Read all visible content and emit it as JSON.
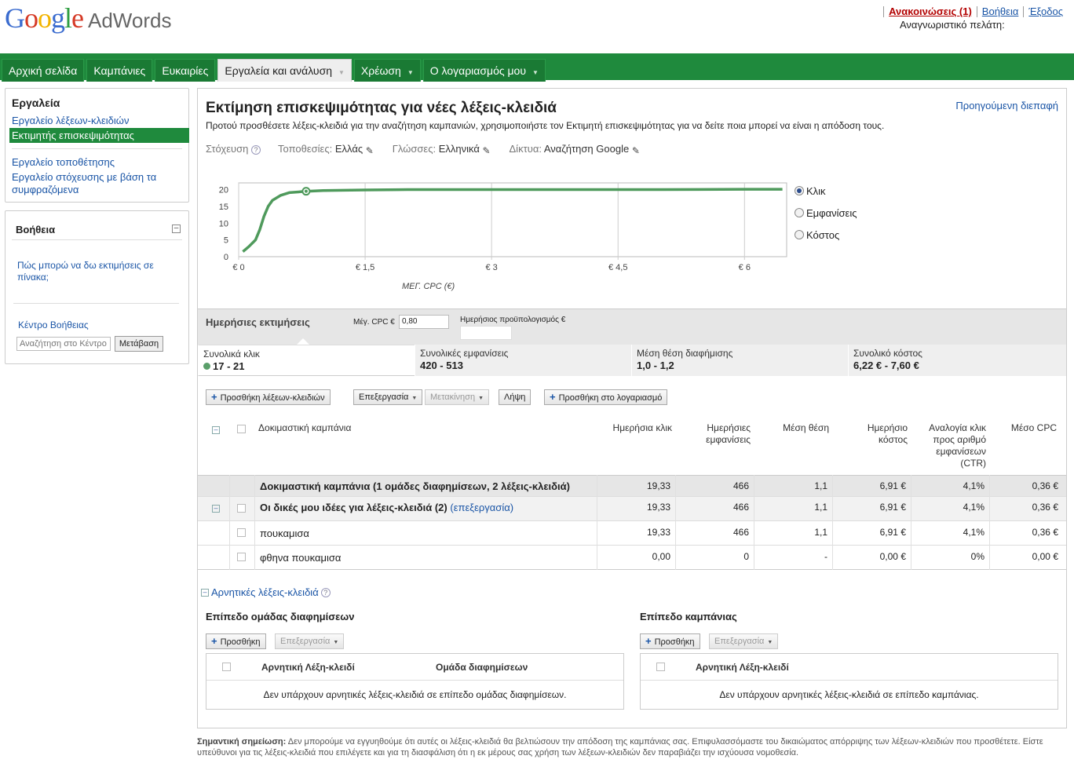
{
  "header": {
    "logo_google": "Google",
    "logo_product": "AdWords",
    "announcements": "Ανακοινώσεις (1)",
    "help": "Βοήθεια",
    "logout": "Έξοδος",
    "customer_id_label": "Αναγνωριστικό πελάτη:"
  },
  "nav": {
    "tabs": [
      {
        "label": "Αρχική σελίδα"
      },
      {
        "label": "Καμπάνιες"
      },
      {
        "label": "Ευκαιρίες"
      },
      {
        "label": "Εργαλεία και ανάλυση"
      },
      {
        "label": "Χρέωση"
      },
      {
        "label": "Ο λογαριασμός μου"
      }
    ]
  },
  "sidebar": {
    "tools_title": "Εργαλεία",
    "items": [
      {
        "label": "Εργαλείο λέξεων-κλειδιών"
      },
      {
        "label": "Εκτιμητής επισκεψιμότητας"
      },
      {
        "label": "Εργαλείο τοποθέτησης"
      },
      {
        "label": "Εργαλείο στόχευσης με βάση τα συμφραζόμενα"
      }
    ],
    "help_title": "Βοήθεια",
    "help_question": "Πώς μπορώ να δω εκτιμήσεις σε πίνακα;",
    "help_center": "Κέντρο Βοήθειας",
    "help_search_placeholder": "Αναζήτηση στο Κέντρο",
    "help_go": "Μετάβαση"
  },
  "main": {
    "title": "Εκτίμηση επισκεψιμότητας για νέες λέξεις-κλειδιά",
    "prev_ui": "Προηγούμενη διεπαφή",
    "subtitle": "Προτού προσθέσετε λέξεις-κλειδιά για την αναζήτηση καμπανιών, χρησιμοποιήστε τον Εκτιμητή επισκεψιμότητας για να δείτε ποια μπορεί να είναι η απόδοση τους.",
    "targeting": {
      "label": "Στόχευση",
      "locations_label": "Τοποθεσίες:",
      "locations_value": "Ελλάς",
      "languages_label": "Γλώσσες:",
      "languages_value": "Ελληνικά",
      "networks_label": "Δίκτυα:",
      "networks_value": "Αναζήτηση Google"
    },
    "metric_options": [
      {
        "label": "Κλικ",
        "selected": true
      },
      {
        "label": "Εμφανίσεις",
        "selected": false
      },
      {
        "label": "Κόστος",
        "selected": false
      }
    ]
  },
  "chart_data": {
    "type": "line",
    "xlabel": "ΜΕΓ. CPC (€)",
    "ylabel": "",
    "xlim": [
      0,
      6.5
    ],
    "ylim": [
      0,
      22
    ],
    "x_ticks": [
      "€ 0",
      "€ 1,5",
      "€ 3",
      "€ 4,5",
      "€ 6"
    ],
    "x_tick_values": [
      0,
      1.5,
      3,
      4.5,
      6
    ],
    "y_ticks": [
      "0",
      "5",
      "10",
      "15",
      "20"
    ],
    "y_tick_values": [
      0,
      5,
      10,
      15,
      20
    ],
    "series": [
      {
        "color": "#4f9a5c",
        "x": [
          0.05,
          0.12,
          0.2,
          0.25,
          0.3,
          0.35,
          0.4,
          0.5,
          0.6,
          0.8,
          1.0,
          1.5,
          2.0,
          3.0,
          4.0,
          5.0,
          6.0,
          6.45
        ],
        "y": [
          1.5,
          3,
          5,
          8,
          12,
          15,
          16.8,
          18.3,
          19.1,
          19.5,
          19.7,
          19.9,
          20,
          20,
          20,
          20,
          20.1,
          20.1
        ]
      }
    ],
    "marker": {
      "x": 0.8,
      "y": 19.5
    }
  },
  "estimates": {
    "label": "Ημερήσιες εκτιμήσεις",
    "max_cpc_label": "Μέγ. CPC €",
    "max_cpc_value": "0,80",
    "budget_label": "Ημερήσιος προϋπολογισμός €",
    "summary": [
      {
        "label": "Συνολικά κλικ",
        "value": "17 - 21"
      },
      {
        "label": "Συνολικές εμφανίσεις",
        "value": "420 - 513"
      },
      {
        "label": "Μέση θέση διαφήμισης",
        "value": "1,0 - 1,2"
      },
      {
        "label": "Συνολικό κόστος",
        "value": "6,22 € - 7,60 €"
      }
    ]
  },
  "toolbar": {
    "add_keywords": "Προσθήκη λέξεων-κλειδιών",
    "edit": "Επεξεργασία",
    "move": "Μετακίνηση",
    "download": "Λήψη",
    "add_to_account": "Προσθήκη στο λογαριασμό"
  },
  "table": {
    "campaign_header": "Δοκιμαστική καμπάνια",
    "columns": [
      "Ημερήσια κλικ",
      "Ημερήσιες εμφανίσεις",
      "Μέση θέση",
      "Ημερήσιο κόστος",
      "Αναλογία κλικ προς αριθμό εμφανίσεων (CTR)",
      "Μέσο CPC"
    ],
    "rows": [
      {
        "name": "Δοκιμαστική καμπάνια (1 ομάδες διαφημίσεων, 2 λέξεις-κλειδιά)",
        "clicks": "19,33",
        "impr": "466",
        "pos": "1,1",
        "cost": "6,91 €",
        "ctr": "4,1%",
        "cpc": "0,36 €"
      },
      {
        "name": "Οι δικές μου ιδέες για λέξεις-κλειδιά (2)",
        "edit_link": "(επεξεργασία)",
        "clicks": "19,33",
        "impr": "466",
        "pos": "1,1",
        "cost": "6,91 €",
        "ctr": "4,1%",
        "cpc": "0,36 €"
      },
      {
        "name": "πουκαμισα",
        "clicks": "19,33",
        "impr": "466",
        "pos": "1,1",
        "cost": "6,91 €",
        "ctr": "4,1%",
        "cpc": "0,36 €"
      },
      {
        "name": "φθηνα πουκαμισα",
        "clicks": "0,00",
        "impr": "0",
        "pos": "-",
        "cost": "0,00 €",
        "ctr": "0%",
        "cpc": "0,00 €"
      }
    ]
  },
  "negative": {
    "toggle": "Αρνητικές λέξεις-κλειδιά",
    "adgroup_title": "Επίπεδο ομάδας διαφημίσεων",
    "campaign_title": "Επίπεδο καμπάνιας",
    "add": "Προσθήκη",
    "edit": "Επεξεργασία",
    "col_keyword": "Αρνητική Λέξη-κλειδί",
    "col_adgroup": "Ομάδα διαφημίσεων",
    "adgroup_empty": "Δεν υπάρχουν αρνητικές λέξεις-κλειδιά σε επίπεδο ομάδας διαφημίσεων.",
    "campaign_empty": "Δεν υπάρχουν αρνητικές λέξεις-κλειδιά σε επίπεδο καμπάνιας."
  },
  "footer": {
    "note_label": "Σημαντική σημείωση:",
    "note_text": " Δεν μπορούμε να εγγυηθούμε ότι αυτές οι λέξεις-κλειδιά θα βελτιώσουν την απόδοση της καμπάνιας σας. Επιφυλασσόμαστε του δικαιώματος απόρριψης των λέξεων-κλειδιών που προσθέτετε. Είστε υπεύθυνοι για τις λέξεις-κλειδιά που επιλέγετε και για τη διασφάλιση ότι η εκ μέρους σας χρήση των λέξεων-κλειδιών δεν παραβιάζει την ισχύουσα νομοθεσία."
  }
}
